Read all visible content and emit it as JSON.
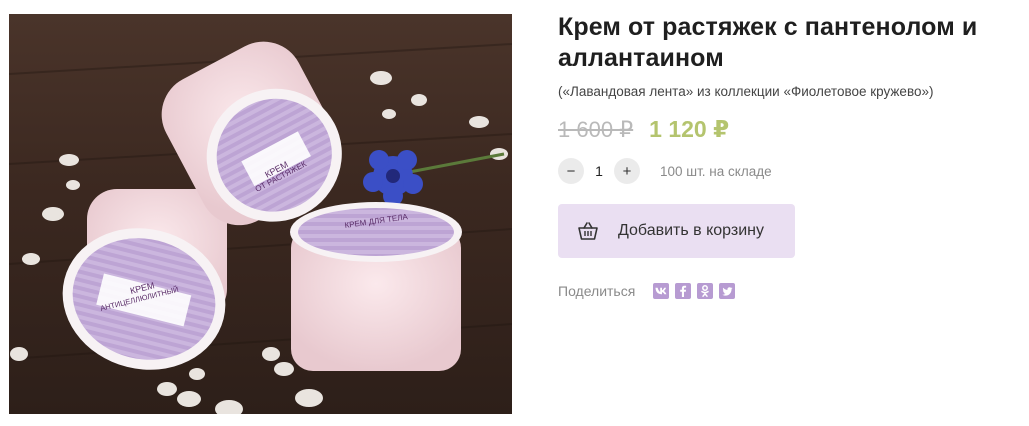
{
  "product": {
    "title_line1": "Крем от растяжек с пантенолом и",
    "title_line2": "аллантаином",
    "subtitle": "(«Лавандовая лента» из коллекции «Фиолетовое кружево»)",
    "old_price": "1 600 ₽",
    "new_price": "1 120 ₽",
    "quantity": "1",
    "decrease_label": "−",
    "increase_label": "+",
    "stock": "100 шт. на складе",
    "add_to_cart": "Добавить в корзину",
    "share_label": "Поделиться"
  },
  "image": {
    "jar1_line1": "КРЕМ",
    "jar1_line2": "ОТ РАСТЯЖЕК",
    "jar2_line1": "КРЕМ",
    "jar2_line2": "АНТИЦЕЛЛЮЛИТНЫЙ",
    "jar3_line1": "КРЕМ ДЛЯ ТЕЛА"
  },
  "social": [
    {
      "name": "vk-icon",
      "glyph": "vk"
    },
    {
      "name": "facebook-icon",
      "glyph": "f"
    },
    {
      "name": "odnoklassniki-icon",
      "glyph": "ok"
    },
    {
      "name": "twitter-icon",
      "glyph": "t"
    }
  ],
  "colors": {
    "accent_price": "#b4c46e",
    "cart_button": "#eadff2",
    "social": "#b79bd2"
  }
}
